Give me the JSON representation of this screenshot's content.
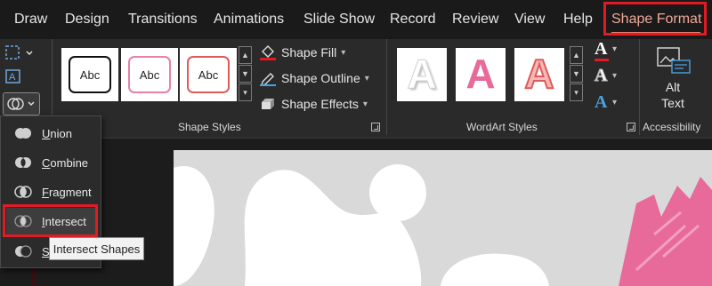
{
  "tabs": [
    {
      "label": "Draw"
    },
    {
      "label": "Design"
    },
    {
      "label": "Transitions"
    },
    {
      "label": "Animations"
    },
    {
      "label": "Slide Show"
    },
    {
      "label": "Record"
    },
    {
      "label": "Review"
    },
    {
      "label": "View"
    },
    {
      "label": "Help"
    },
    {
      "label": "Shape Format",
      "active": true
    }
  ],
  "shape_styles": {
    "group_label": "Shape Styles",
    "presets": [
      {
        "text": "Abc",
        "border_color": "#111111"
      },
      {
        "text": "Abc",
        "border_color": "#e880a8"
      },
      {
        "text": "Abc",
        "border_color": "#e05a5a"
      }
    ],
    "shape_fill": "Shape Fill",
    "shape_outline": "Shape Outline",
    "shape_effects": "Shape Effects"
  },
  "wordart_styles": {
    "group_label": "WordArt Styles",
    "presets": [
      {
        "letter": "A",
        "style": "white-outline"
      },
      {
        "letter": "A",
        "style": "pink-fill"
      },
      {
        "letter": "A",
        "style": "red-outline"
      }
    ]
  },
  "accessibility": {
    "group_label": "Accessibility",
    "alt_text_line1": "Alt",
    "alt_text_line2": "Text"
  },
  "merge_menu": {
    "items": [
      {
        "label_first": "U",
        "label_rest": "nion"
      },
      {
        "label_first": "C",
        "label_rest": "ombine"
      },
      {
        "label_first": "F",
        "label_rest": "ragment"
      },
      {
        "label_first": "I",
        "label_rest": "ntersect",
        "selected": true
      },
      {
        "label_first": "S",
        "label_rest": ""
      }
    ]
  },
  "tooltip": "Intersect Shapes",
  "colors": {
    "accent_red": "#e01b24",
    "active_tab_text": "#f0a898",
    "slide_bg": "#d9d9d9",
    "slide_pink": "#e86a9a"
  }
}
